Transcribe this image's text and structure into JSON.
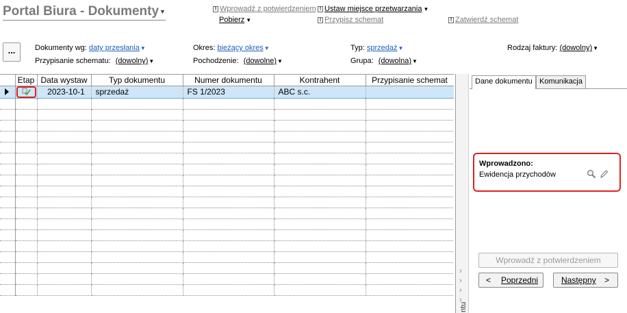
{
  "title": "Portal Biura - Dokumenty",
  "actions": {
    "confirm_enter": "Wprowadź z potwierdzeniem",
    "fetch": "Pobierz",
    "set_processing_place": "Ustaw miejsce przetwarzania",
    "assign_schema": "Przypisz schemat",
    "approve_schema": "Zatwierdź schemat",
    "more": "..."
  },
  "filters": {
    "documents_by_label": "Dokumenty wg:",
    "documents_by_value": "daty przesłania",
    "period_label": "Okres:",
    "period_value": "bieżący okres",
    "type_label": "Typ:",
    "type_value": "sprzedaż",
    "invoice_kind_label": "Rodzaj faktury:",
    "invoice_kind_value": "(dowolny)",
    "schema_assign_label": "Przypisanie schematu:",
    "schema_assign_value": "(dowolny)",
    "origin_label": "Pochodzenie:",
    "origin_value": "(dowolne)",
    "group_label": "Grupa:",
    "group_value": "(dowolna)"
  },
  "grid": {
    "columns": [
      "Etap",
      "Data wystaw",
      "Typ dokumentu",
      "Numer dokumentu",
      "Kontrahent",
      "Przypisanie schemat"
    ],
    "rows": [
      {
        "date": "2023-10-1",
        "doc_type": "sprzedaż",
        "doc_number": "FS 1/2023",
        "contractor": "ABC s.c.",
        "schema": ""
      }
    ]
  },
  "side_strip_text": "ntu",
  "panel": {
    "tabs": [
      "Dane dokumentu",
      "Komunikacja"
    ],
    "entered_title": "Wprowadzono:",
    "entered_value": "Ewidencja przychodów",
    "confirm_button": "Wprowadź z potwierdzeniem",
    "prev_button": "Poprzedni",
    "next_button": "Następny"
  },
  "colors": {
    "highlight_red": "#e02020",
    "selected_row": "#cfe6f8",
    "link_blue": "#1f5fbf"
  }
}
